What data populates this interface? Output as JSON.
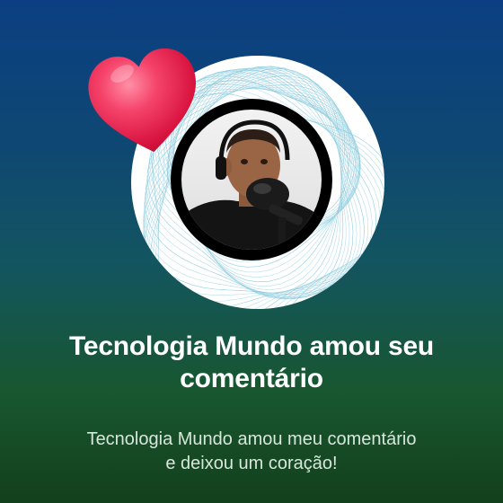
{
  "notification": {
    "title_line1": "Tecnologia Mundo amou seu",
    "title_line2": "comentário",
    "message_line1": "Tecnologia Mundo amou meu comentário",
    "message_line2": "e deixou um coração!",
    "reaction_icon": "heart-icon"
  },
  "colors": {
    "background_top": "#0b3f82",
    "background_bottom": "#133f1c",
    "heart": "#f0335a",
    "avatar_ring": "#000000"
  }
}
